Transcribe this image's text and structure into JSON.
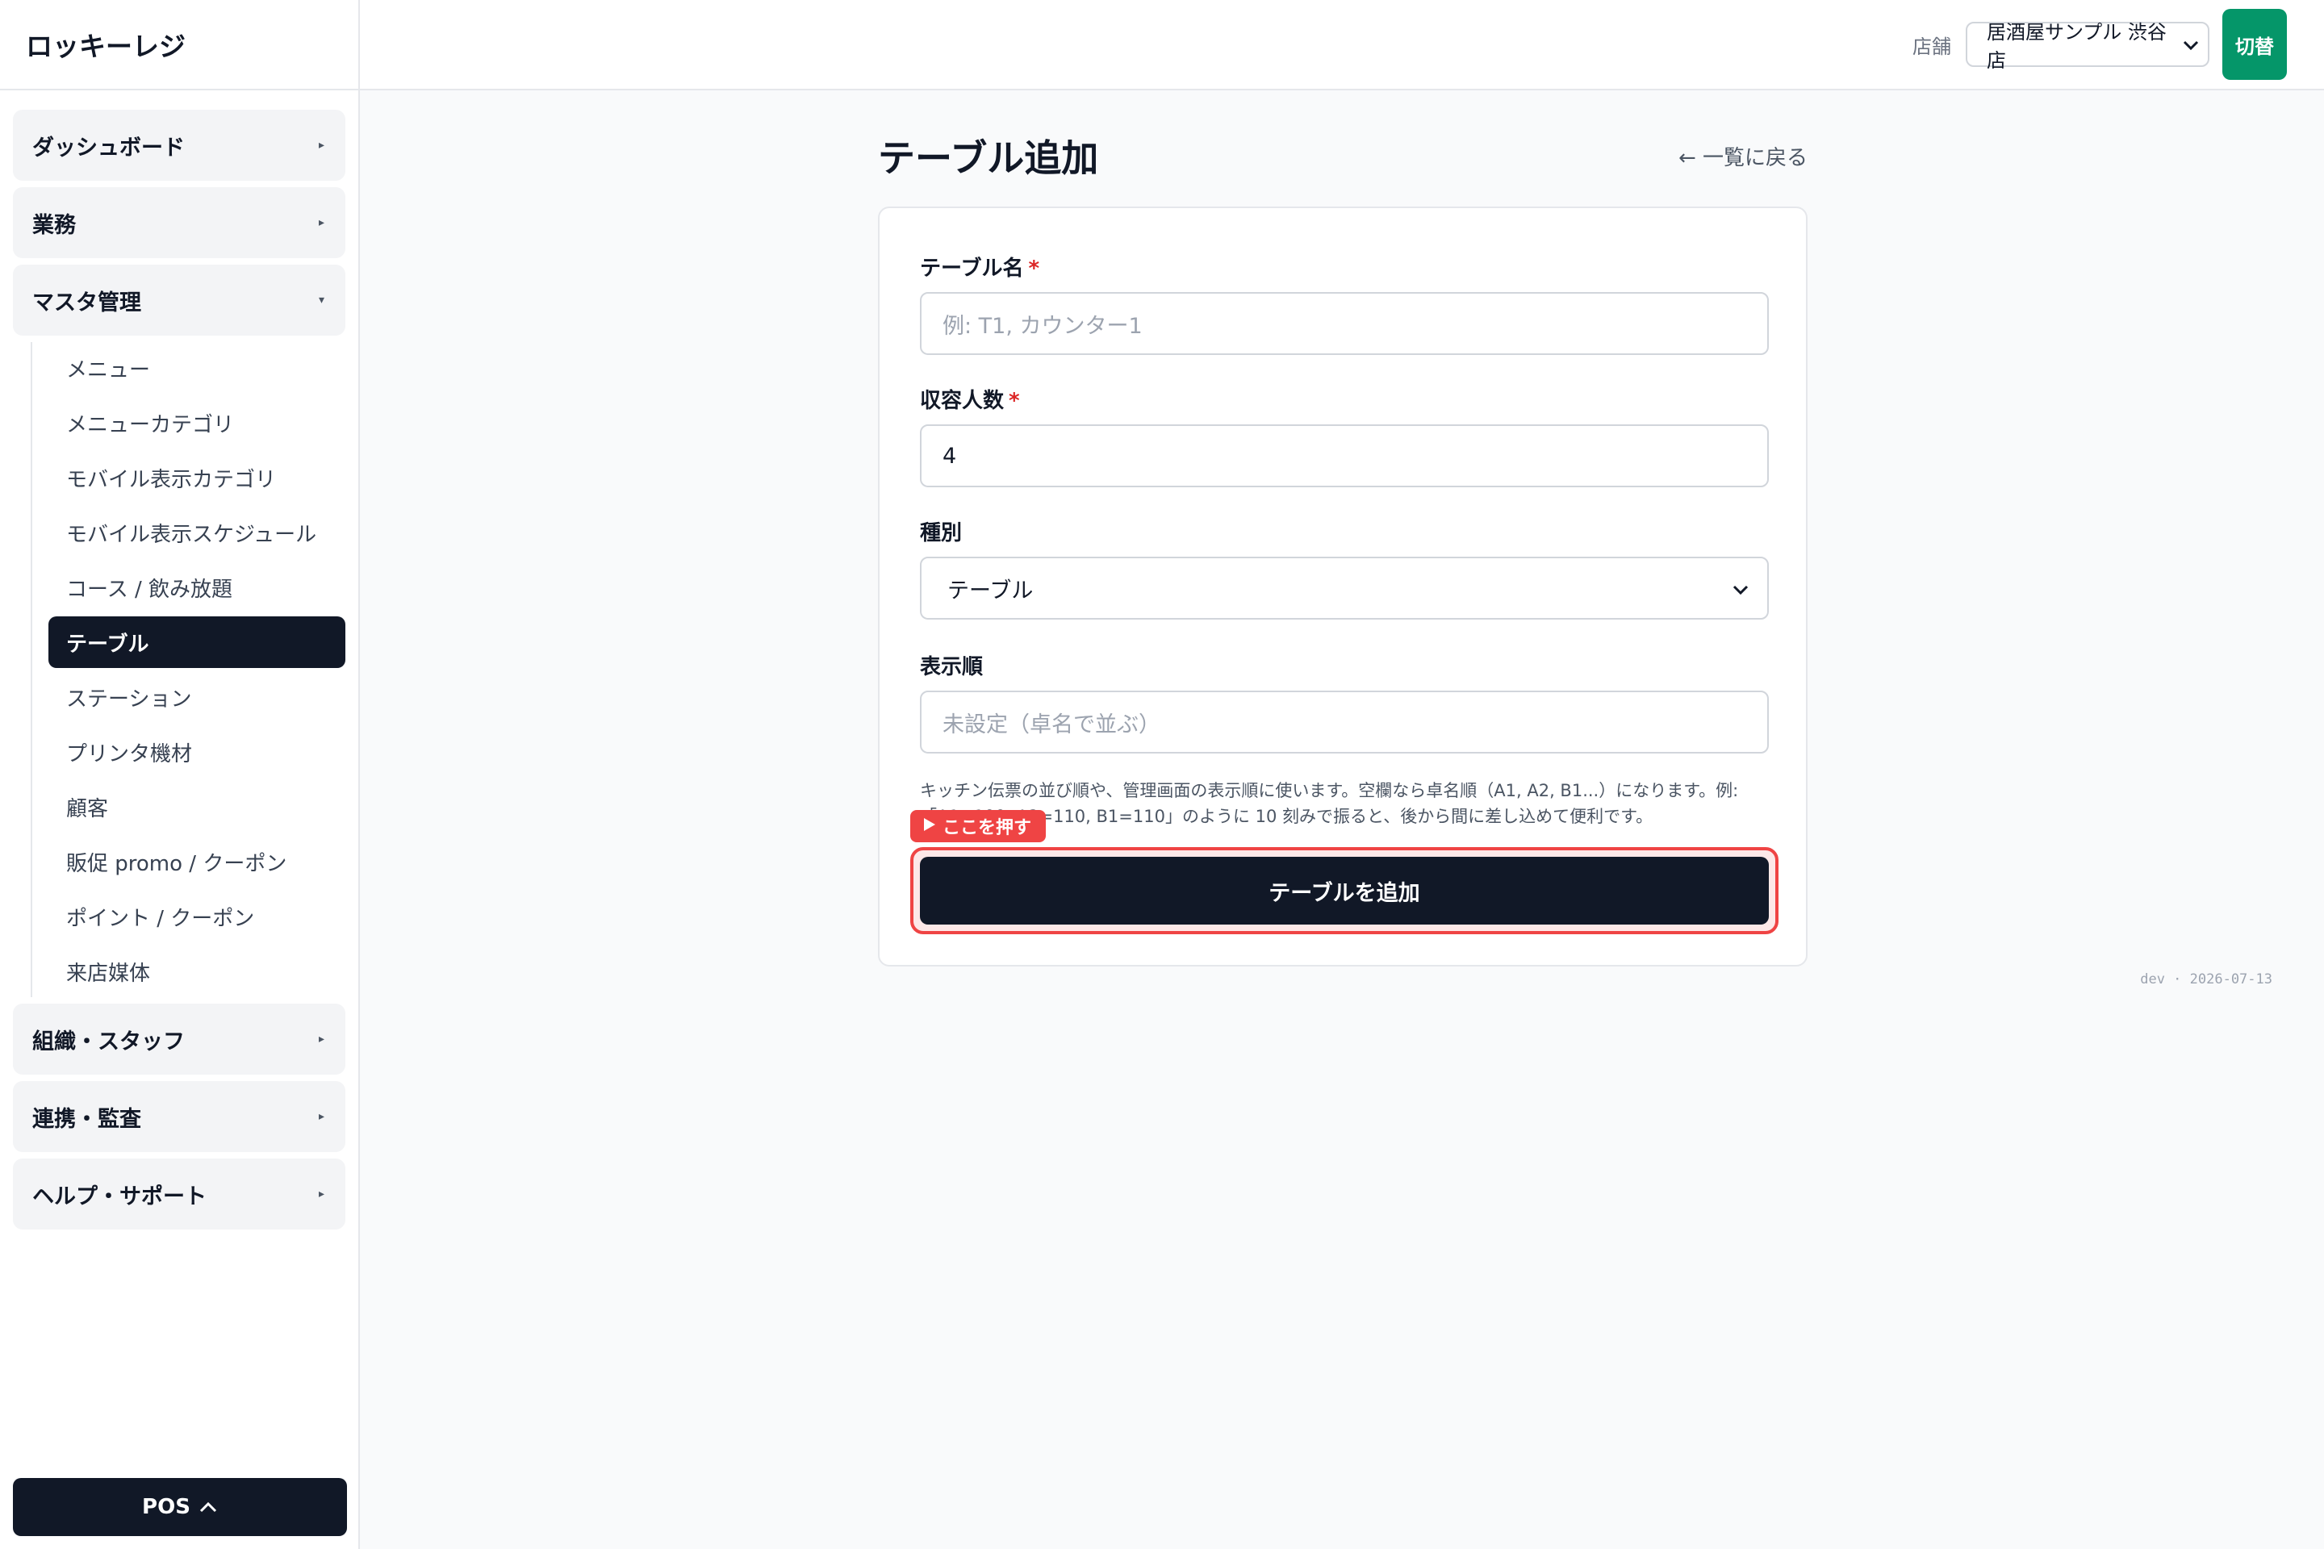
{
  "app": {
    "title": "ロッキーレジ"
  },
  "sidebar": {
    "groups": [
      {
        "label": "ダッシュボード",
        "caret": "▸"
      },
      {
        "label": "業務",
        "caret": "▸"
      },
      {
        "label": "マスタ管理",
        "caret": "▾"
      },
      {
        "label": "組織・スタッフ",
        "caret": "▸"
      },
      {
        "label": "連携・監査",
        "caret": "▸"
      },
      {
        "label": "ヘルプ・サポート",
        "caret": "▸"
      }
    ],
    "master_items": [
      "メニュー",
      "メニューカテゴリ",
      "モバイル表示カテゴリ",
      "モバイル表示スケジュール",
      "コース / 飲み放題",
      "テーブル",
      "ステーション",
      "プリンタ機材",
      "顧客",
      "販促 promo / クーポン",
      "ポイント / クーポン",
      "来店媒体"
    ],
    "active_item": "テーブル",
    "pos_label": "POS",
    "pos_icon": "^"
  },
  "topbar": {
    "store_label": "店舗",
    "store_value": "居酒屋サンプル 渋谷店",
    "switch_label": "切替"
  },
  "page": {
    "title": "テーブル追加",
    "back_link": "← 一覧に戻る"
  },
  "form": {
    "name_label": "テーブル名",
    "name_placeholder": "例: T1, カウンター1",
    "capacity_label": "収容人数",
    "capacity_value": "4",
    "type_label": "種別",
    "type_value": "テーブル",
    "order_label": "表示順",
    "order_placeholder": "未設定（卓名で並ぶ）",
    "required_mark": "*",
    "help_text": "キッチン伝票の並び順や、管理画面の表示順に使います。空欄なら卓名順（A1, A2, B1...）になります。例: 「A1=100, A2=110, B1=110」のように 10 刻みで振ると、後から間に差し込めて便利です。",
    "press_badge": "ここを押す",
    "submit_label": "テーブルを追加"
  },
  "footer": {
    "meta": "dev · 2026-07-13"
  },
  "colors": {
    "primary_dark": "#111827",
    "accent_green": "#059669",
    "highlight_red": "#ef4444",
    "required_red": "#dc2626"
  }
}
